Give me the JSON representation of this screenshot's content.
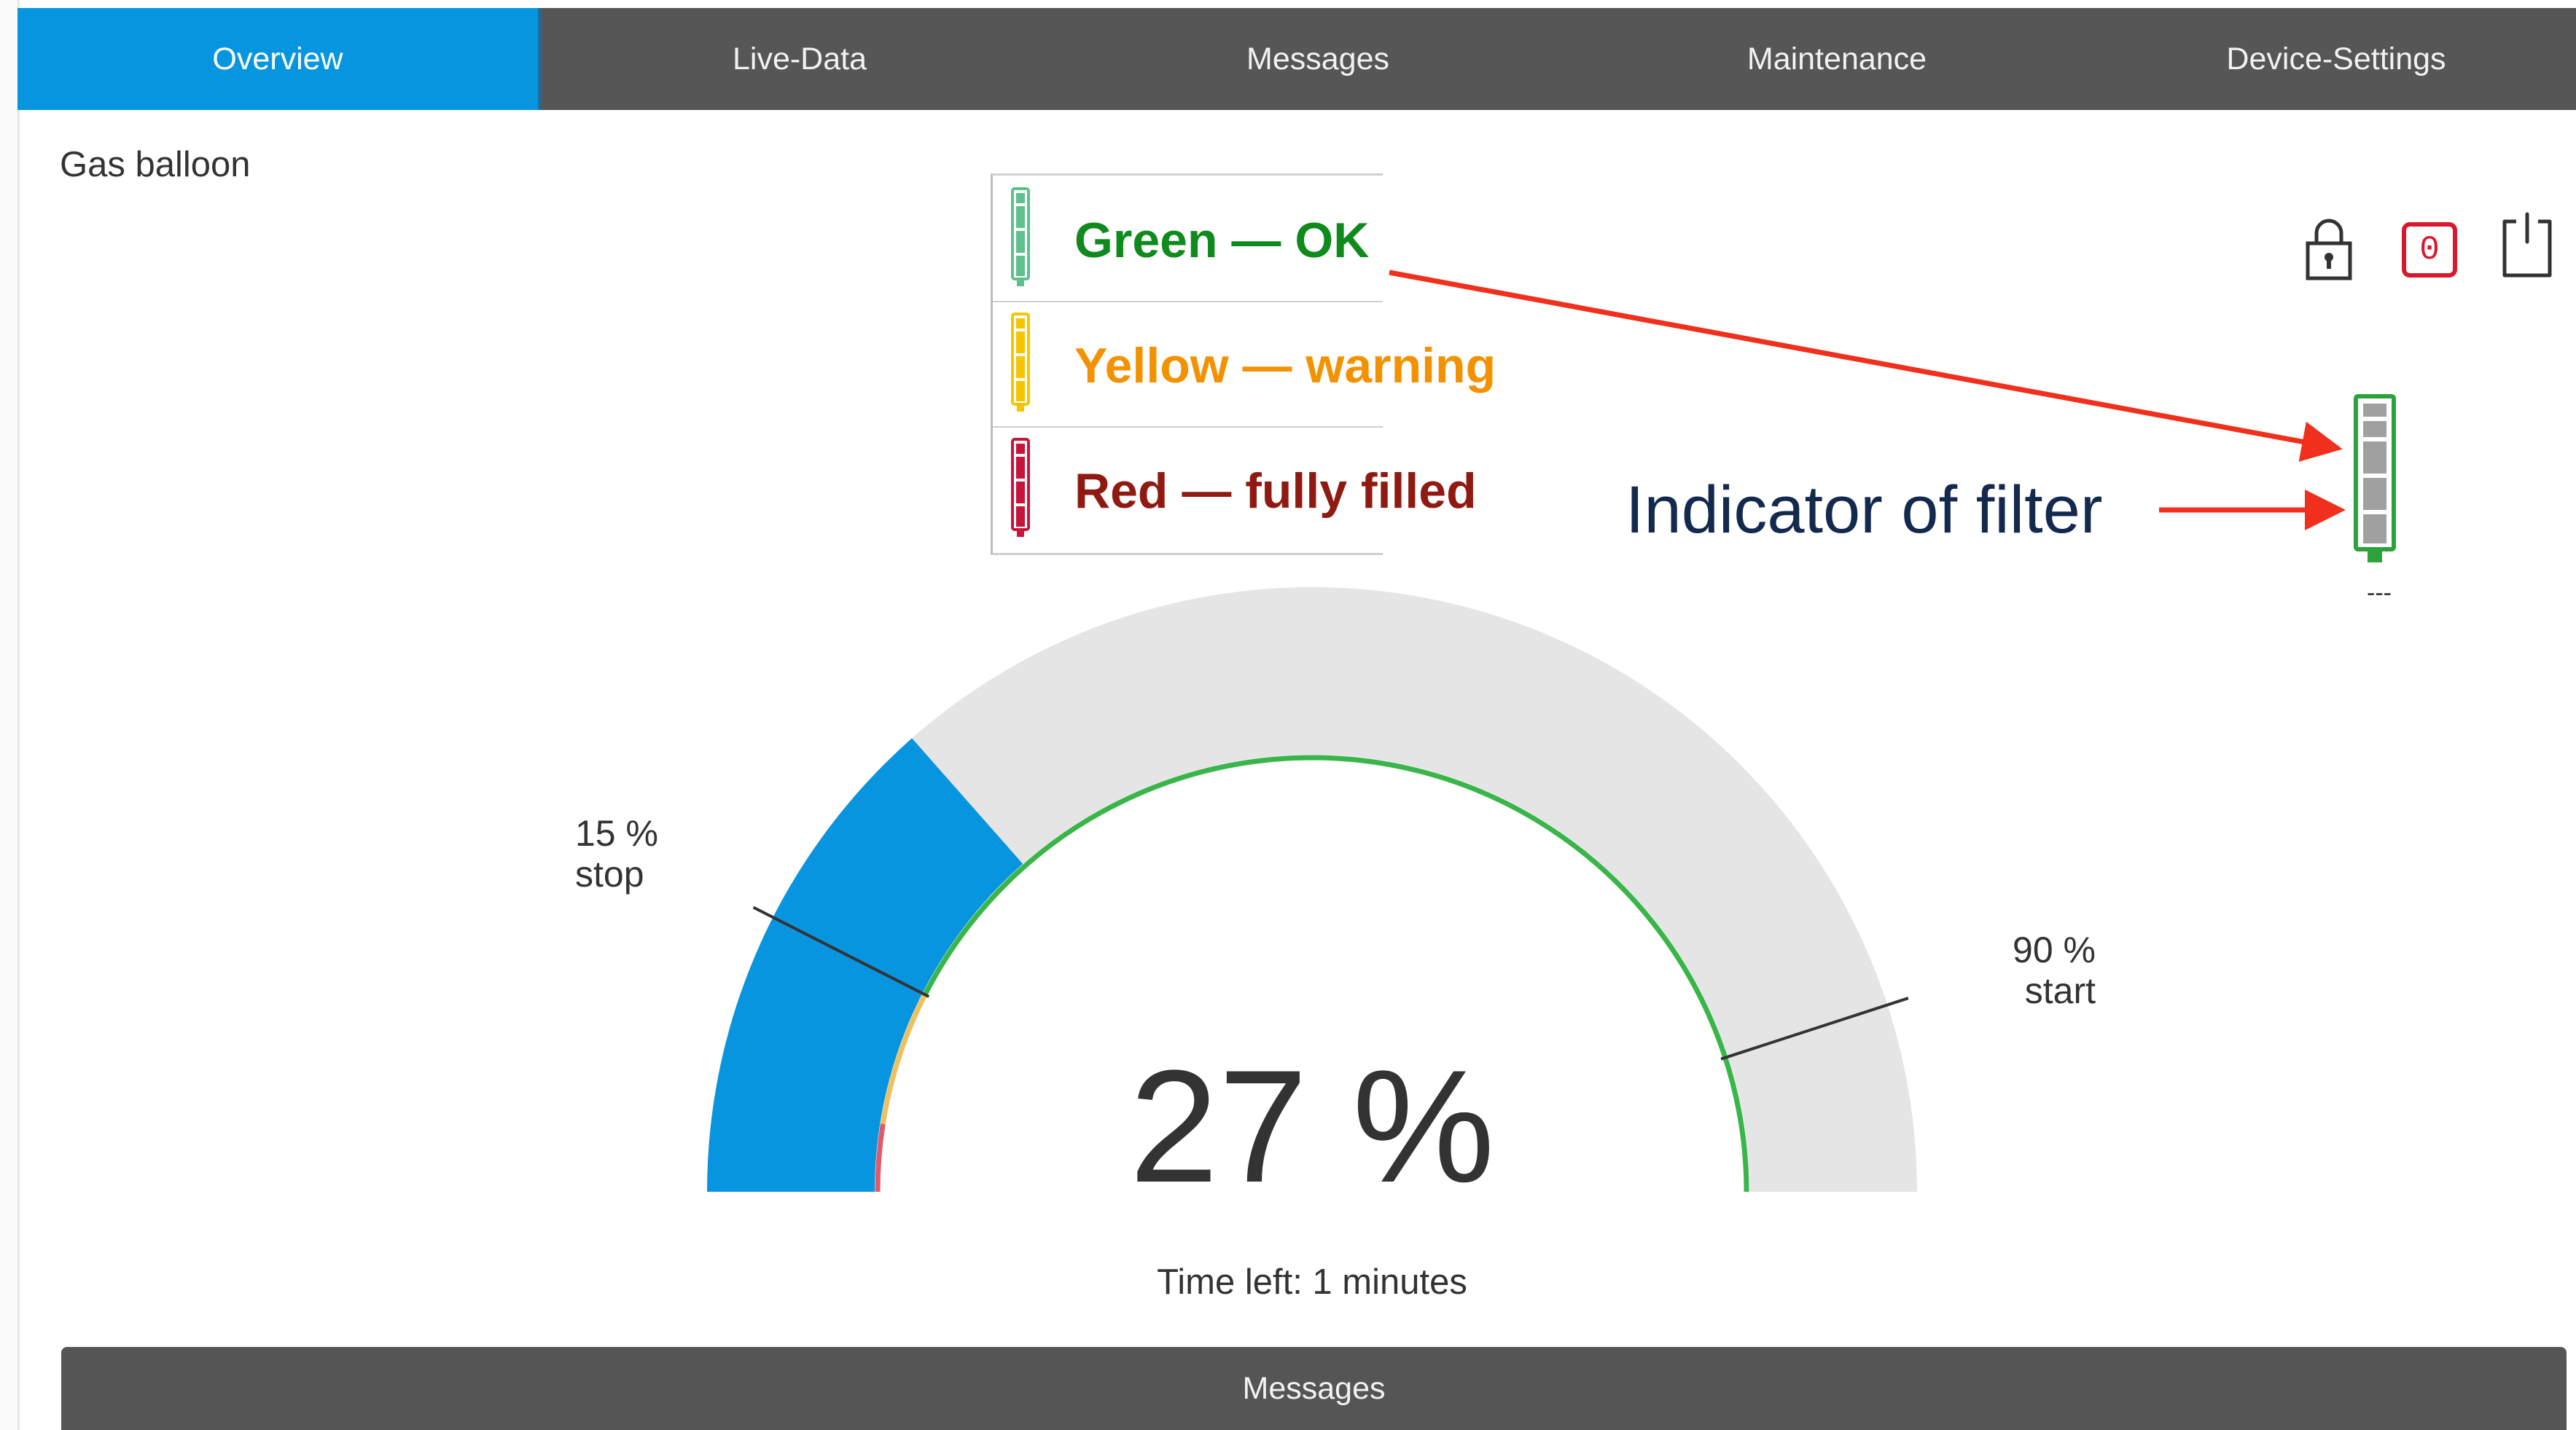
{
  "tabs": [
    {
      "label": "Overview",
      "active": true
    },
    {
      "label": "Live-Data",
      "active": false
    },
    {
      "label": "Messages",
      "active": false
    },
    {
      "label": "Maintenance",
      "active": false
    },
    {
      "label": "Device-Settings",
      "active": false
    }
  ],
  "page": {
    "title": "Gas balloon"
  },
  "legend": {
    "items": [
      {
        "label": "Green — OK",
        "color": "#0f8a1c",
        "icon_color": "#5fbf8f",
        "icon": "filter-green-icon"
      },
      {
        "label": "Yellow — warning",
        "color": "#f39200",
        "icon_color": "#f7c500",
        "icon": "filter-yellow-icon"
      },
      {
        "label": "Red — fully filled",
        "color": "#8f1a12",
        "icon_color": "#c8133a",
        "icon": "filter-red-icon"
      }
    ]
  },
  "toolbar": {
    "lock_icon": "lock-icon",
    "counter_value": "0",
    "counter_color": "#d8182c",
    "power_icon": "power-icon"
  },
  "annotation": {
    "text": "Indicator of filter",
    "arrow_color": "#f0301c"
  },
  "filter_indicator": {
    "status": "green",
    "color": "#2ba33a",
    "value": "---"
  },
  "gauge": {
    "value_percent": 27,
    "value_text": "27 %",
    "stop_marker": {
      "percent": 15,
      "text_percent": "15 %",
      "text_label": "stop"
    },
    "start_marker": {
      "percent": 90,
      "text_percent": "90 %",
      "text_label": "start"
    },
    "time_left": "Time left: 1 minutes",
    "colors": {
      "fill": "#0795e0",
      "track": "#e5e5e5",
      "ok": "#3ab54a",
      "warning": "#f0c060",
      "critical": "#e05a6a"
    }
  },
  "messages_panel": {
    "title": "Messages"
  }
}
